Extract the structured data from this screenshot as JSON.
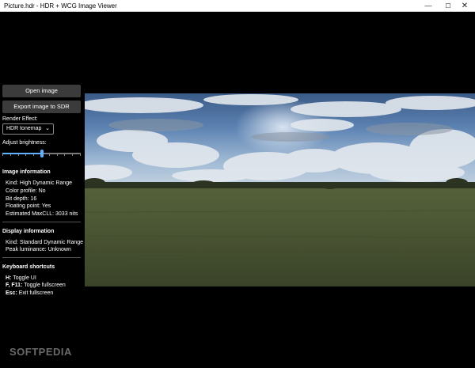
{
  "window": {
    "title": "Picture.hdr - HDR + WCG Image Viewer",
    "minimize_glyph": "—",
    "maximize_glyph": "☐",
    "close_glyph": "✕"
  },
  "sidebar": {
    "open_button": "Open image",
    "export_button": "Export image to SDR",
    "render_effect_label": "Render Effect:",
    "render_effect_value": "HDR tonemap",
    "brightness_label": "Adjust brightness:",
    "brightness_value": 0.5
  },
  "image_info": {
    "title": "Image information",
    "kind": "Kind: High Dynamic Range",
    "color_profile": "Color profile: No",
    "bit_depth": "Bit depth: 16",
    "floating_point": "Floating point: Yes",
    "max_cll": "Estimated MaxCLL: 3033 nits"
  },
  "display_info": {
    "title": "Display information",
    "kind": "Kind: Standard Dynamic Range",
    "peak": "Peak luminance: Unknown"
  },
  "shortcuts": {
    "title": "Keyboard shortcuts",
    "items": [
      {
        "key": "H:",
        "desc": " Toggle UI"
      },
      {
        "key": "F, F11:",
        "desc": " Toggle fullscreen"
      },
      {
        "key": "Esc:",
        "desc": " Exit fullscreen"
      }
    ]
  },
  "watermark": "SOFTPEDIA",
  "colors": {
    "accent": "#5fb2ff",
    "button_bg": "#3b3b3b"
  }
}
